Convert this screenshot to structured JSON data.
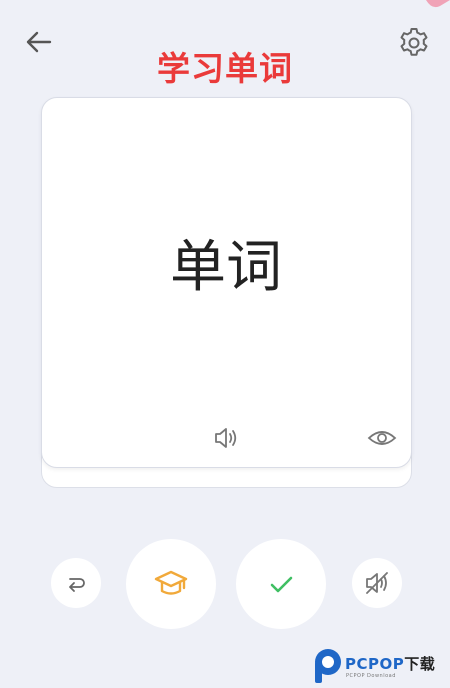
{
  "header": {
    "title": "学习单词",
    "back_icon": "arrow-left-icon",
    "settings_icon": "gear-icon"
  },
  "card": {
    "word": "单词",
    "speaker_icon": "speaker-icon",
    "reveal_icon": "eye-icon"
  },
  "actions": {
    "repeat_icon": "repeat-icon",
    "learn_icon": "graduation-cap-icon",
    "known_icon": "checkmark-icon",
    "mute_icon": "speaker-muted-icon"
  },
  "watermark": {
    "brand": "PCPOP",
    "suffix": "下载",
    "sub": "PCPOP Download"
  },
  "colors": {
    "title": "#ea3a3a",
    "background": "#eef0f7",
    "learn_icon": "#f1a93a",
    "known_icon": "#3fbf63",
    "watermark_blue": "#1f67c7"
  }
}
